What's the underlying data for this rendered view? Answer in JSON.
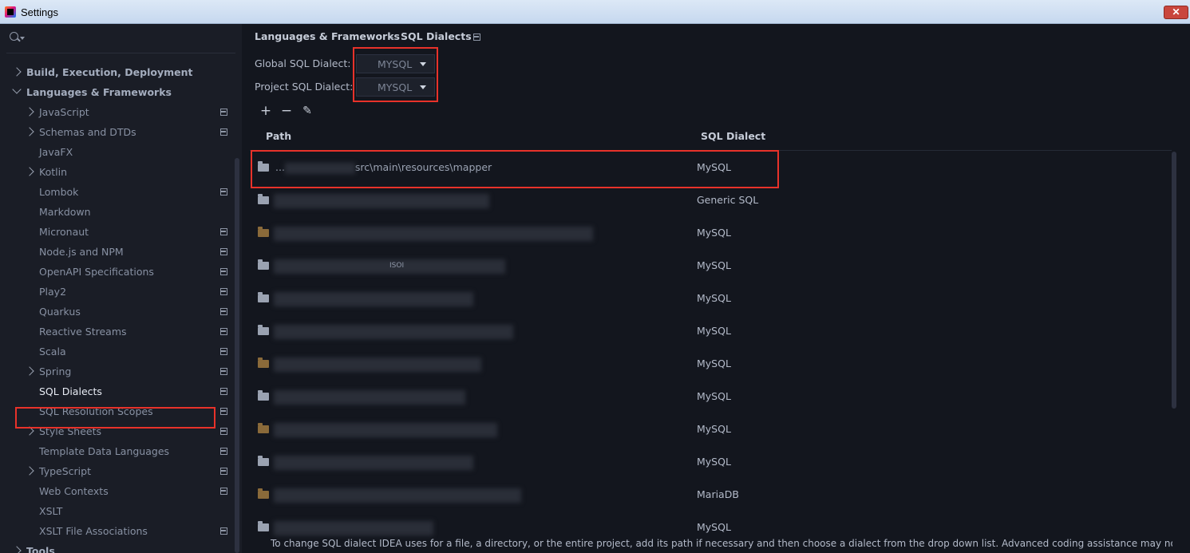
{
  "window": {
    "title": "Settings",
    "close": "✕"
  },
  "search": {
    "placeholder": "",
    "value": ""
  },
  "sidebar": {
    "items": [
      {
        "label": "Build, Execution, Deployment",
        "bold": true,
        "chevron": "right",
        "indent": 0,
        "project_icon": false
      },
      {
        "label": "Languages & Frameworks",
        "bold": true,
        "chevron": "down",
        "indent": 0,
        "project_icon": false
      },
      {
        "label": "JavaScript",
        "chevron": "right",
        "indent": 1,
        "project_icon": true
      },
      {
        "label": "Schemas and DTDs",
        "chevron": "right",
        "indent": 1,
        "project_icon": true
      },
      {
        "label": "JavaFX",
        "chevron": "none",
        "indent": 1,
        "project_icon": false
      },
      {
        "label": "Kotlin",
        "chevron": "right",
        "indent": 1,
        "project_icon": false
      },
      {
        "label": "Lombok",
        "chevron": "none",
        "indent": 1,
        "project_icon": true
      },
      {
        "label": "Markdown",
        "chevron": "none",
        "indent": 1,
        "project_icon": false
      },
      {
        "label": "Micronaut",
        "chevron": "none",
        "indent": 1,
        "project_icon": true
      },
      {
        "label": "Node.js and NPM",
        "chevron": "none",
        "indent": 1,
        "project_icon": true
      },
      {
        "label": "OpenAPI Specifications",
        "chevron": "none",
        "indent": 1,
        "project_icon": true
      },
      {
        "label": "Play2",
        "chevron": "none",
        "indent": 1,
        "project_icon": true
      },
      {
        "label": "Quarkus",
        "chevron": "none",
        "indent": 1,
        "project_icon": true
      },
      {
        "label": "Reactive Streams",
        "chevron": "none",
        "indent": 1,
        "project_icon": true
      },
      {
        "label": "Scala",
        "chevron": "none",
        "indent": 1,
        "project_icon": true
      },
      {
        "label": "Spring",
        "chevron": "right",
        "indent": 1,
        "project_icon": true
      },
      {
        "label": "SQL Dialects",
        "chevron": "none",
        "indent": 1,
        "project_icon": true,
        "selected": true
      },
      {
        "label": "SQL Resolution Scopes",
        "chevron": "none",
        "indent": 1,
        "project_icon": true
      },
      {
        "label": "Style Sheets",
        "chevron": "right",
        "indent": 1,
        "project_icon": true
      },
      {
        "label": "Template Data Languages",
        "chevron": "none",
        "indent": 1,
        "project_icon": true
      },
      {
        "label": "TypeScript",
        "chevron": "right",
        "indent": 1,
        "project_icon": true
      },
      {
        "label": "Web Contexts",
        "chevron": "none",
        "indent": 1,
        "project_icon": true
      },
      {
        "label": "XSLT",
        "chevron": "none",
        "indent": 1,
        "project_icon": false
      },
      {
        "label": "XSLT File Associations",
        "chevron": "none",
        "indent": 1,
        "project_icon": true
      },
      {
        "label": "Tools",
        "bold": true,
        "chevron": "right",
        "indent": 0,
        "project_icon": false
      }
    ]
  },
  "breadcrumb": {
    "parent": "Languages & Frameworks",
    "separator": "›",
    "current": "SQL Dialects"
  },
  "dialects": {
    "global_label": "Global SQL Dialect:",
    "global_value": "MYSQL",
    "project_label": "Project SQL Dialect:",
    "project_value": "MYSQL"
  },
  "toolbar": {
    "add": "+",
    "remove": "−",
    "edit": "✎"
  },
  "table": {
    "columns": [
      "Path",
      "SQL Dialect"
    ],
    "rows": [
      {
        "path": "...",
        "path2": "src\\main\\resources\\mapper",
        "dialect": "MySQL",
        "icon": "folder",
        "blurw": 100
      },
      {
        "path": "",
        "dialect": "Generic SQL",
        "icon": "folder",
        "blurw": 270
      },
      {
        "path": "",
        "dialect": "MySQL",
        "icon": "file",
        "blurw": 400
      },
      {
        "path": "",
        "path2": "ISOI",
        "dialect": "MySQL",
        "icon": "folder",
        "blurw": 290
      },
      {
        "path": "",
        "dialect": "MySQL",
        "icon": "folder",
        "blurw": 250
      },
      {
        "path": "",
        "dialect": "MySQL",
        "icon": "folder",
        "blurw": 300
      },
      {
        "path": "",
        "dialect": "MySQL",
        "icon": "file",
        "blurw": 260
      },
      {
        "path": "",
        "dialect": "MySQL",
        "icon": "folder",
        "blurw": 240
      },
      {
        "path": "",
        "dialect": "MySQL",
        "icon": "file",
        "blurw": 280
      },
      {
        "path": "",
        "dialect": "MySQL",
        "icon": "folder",
        "blurw": 250
      },
      {
        "path": "",
        "dialect": "MariaDB",
        "icon": "file",
        "blurw": 310
      },
      {
        "path": "",
        "dialect": "MySQL",
        "icon": "folder",
        "blurw": 200
      }
    ]
  },
  "footer_text": "To change SQL dialect IDEA uses for a file, a directory, or the entire project, add its path if necessary and then choose a dialect from the drop down list. Advanced coding assistance may not be available for Generic",
  "colors": {
    "highlight_red": "#e8322a",
    "background": "#13161e",
    "sidebar": "#1a1d26"
  }
}
